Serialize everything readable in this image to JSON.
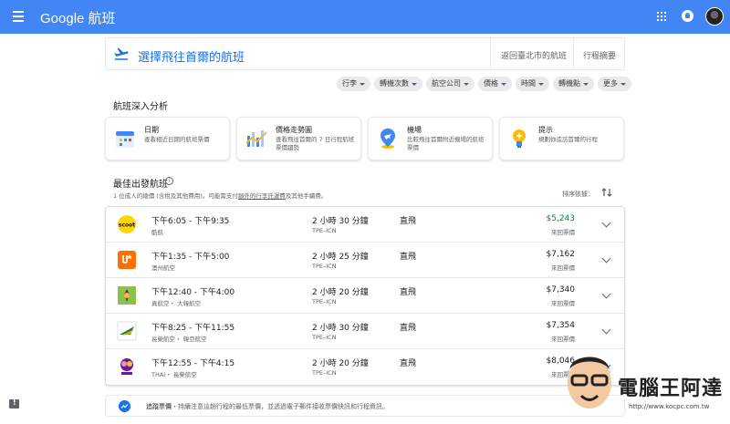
{
  "header": {
    "brand": "Google 航班"
  },
  "breadcrumb": {
    "title": "選擇飛往首爾的航班",
    "return_link": "返回臺北市的航班",
    "summary_link": "行程摘要"
  },
  "filters": [
    "行李",
    "轉機次數",
    "航空公司",
    "價格",
    "時間",
    "轉機點",
    "更多"
  ],
  "insights": {
    "title": "航班深入分析",
    "cards": [
      {
        "title": "日期",
        "desc": "查看相近日期的航班票價",
        "icon": "calendar-icon"
      },
      {
        "title": "價格走勢圖",
        "desc": "查看飛往首爾的 7 日行程航班票價趨勢",
        "icon": "price-graph-icon"
      },
      {
        "title": "機場",
        "desc": "比較飛往首爾附近機場的航班票價",
        "icon": "airport-pin-icon"
      },
      {
        "title": "提示",
        "desc": "規劃你造訪首爾的行程",
        "icon": "lightbulb-icon"
      }
    ]
  },
  "best": {
    "title": "最佳出發航班",
    "note_prefix": "1 位成人的總價 (含稅及其他費用)。可能需支付",
    "note_link": "額外的行李託運費",
    "note_suffix": "及其他手續費。",
    "sort_label": "排序依據：",
    "flights": [
      {
        "times": "下午6:05 - 下午9:35",
        "airline": "酷航",
        "duration": "2 小時 30 分鐘",
        "route": "TPE–ICN",
        "stops": "直飛",
        "price": "$5,243",
        "price_type": "來回票價",
        "cheapest": true,
        "logo": "scoot-logo",
        "logo_color": "#ffd600"
      },
      {
        "times": "下午1:35 - 下午5:00",
        "airline": "澳州航空",
        "duration": "2 小時 25 分鐘",
        "route": "TPE–ICN",
        "stops": "直飛",
        "price": "$7,162",
        "price_type": "來回票價",
        "cheapest": false,
        "logo": "jetstar-logo",
        "logo_color": "#ff6f00"
      },
      {
        "times": "下午12:40 - 下午4:00",
        "airline": "真航空・ 大韓航空",
        "duration": "2 小時 20 分鐘",
        "route": "TPE–ICN",
        "stops": "直飛",
        "price": "$7,340",
        "price_type": "來回票價",
        "cheapest": false,
        "logo": "jinair-logo",
        "logo_color": "#8bc34a"
      },
      {
        "times": "下午8:25 - 下午11:55",
        "airline": "長榮航空・ 韓亞航空",
        "duration": "2 小時 30 分鐘",
        "route": "TPE–ICN",
        "stops": "直飛",
        "price": "$7,354",
        "price_type": "來回票價",
        "cheapest": false,
        "logo": "evaair-logo",
        "logo_color": "#2e7d32"
      },
      {
        "times": "下午12:55 - 下午4:15",
        "airline": "THAI・ 長榮航空",
        "duration": "2 小時 20 分鐘",
        "route": "TPE–ICN",
        "stops": "直飛",
        "price": "$8,046",
        "price_type": "來回票價",
        "cheapest": false,
        "logo": "thai-logo",
        "logo_color": "#6a1b9a"
      }
    ]
  },
  "track": {
    "label": "追蹤票價",
    "desc": "・持續注意這趟行程的最低票價，並透過電子郵件接收票價快訊和行程資訊。"
  },
  "watermark": {
    "text": "電腦王阿達",
    "url": "http://www.kocpc.com.tw"
  },
  "colors": {
    "header_blue": "#4285f4",
    "link_blue": "#1a73e8",
    "cheap_green": "#188038"
  }
}
